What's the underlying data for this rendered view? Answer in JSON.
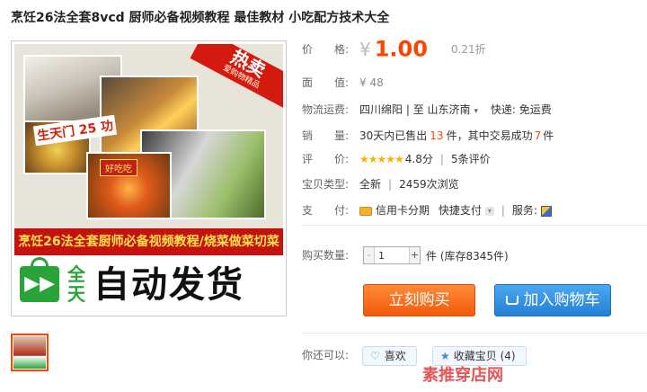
{
  "title": "烹饪26法全套8vcd 厨师必备视频教程 最佳教材 小吃配方技术大全",
  "image": {
    "hot_main": "热卖",
    "hot_sub": "爱购物精品",
    "flag_text": "生天门 25 功",
    "plate_label": "好吃吃",
    "ribbon": "烹饪26法全套厨师必备视频教程/烧菜做菜切菜",
    "delivery_day": "全天",
    "delivery_text": "自动发货"
  },
  "props": {
    "price_label": "价　　格:",
    "yen": "¥",
    "price": "1.00",
    "discount": "0.21折",
    "face_label": "面　　值:",
    "face_value": "¥ 48",
    "shipping_label": "物流运费:",
    "ship_from": "四川绵阳",
    "ship_to_sep": "| 至",
    "ship_to": "山东济南",
    "ship_fee": "快递: 免运费",
    "sales_label": "销　　量:",
    "sales_prefix": "30天内已售出",
    "sales_count": "13",
    "sales_mid": "件，其中交易成功",
    "sales_success": "7",
    "sales_suffix": "件",
    "rating_label": "评　　价:",
    "rating_stars": "★★★★★",
    "rating_score": "4.8分",
    "rating_reviews": "5条评价",
    "type_label": "宝贝类型:",
    "type_value": "全新",
    "views": "2459次浏览",
    "pay_label": "支　　付:",
    "pay_credit": "信用卡分期",
    "pay_quick": "快捷支付",
    "service_label": "服务:"
  },
  "quantity": {
    "label": "购买数量:",
    "minus": "-",
    "plus": "+",
    "value": "1",
    "unit_stock": "件 (库存8345件)"
  },
  "buttons": {
    "buy": "立刻购买",
    "cart": "加入购物车"
  },
  "also": {
    "label": "你还可以:",
    "like": "喜欢",
    "favorite": "收藏宝贝 (4)"
  },
  "watermark": "素推穿店网",
  "colors": {
    "price": "#ff4400",
    "buy": "#f25a0a",
    "cart": "#2480d6",
    "accent": "#3c8ad8"
  }
}
